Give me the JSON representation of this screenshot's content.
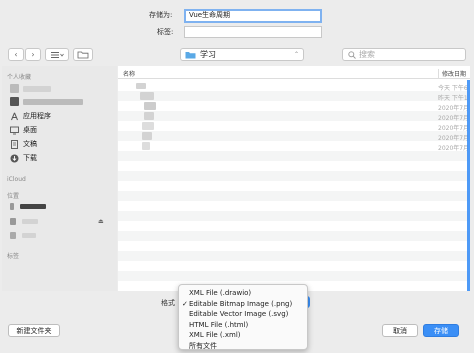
{
  "save_as": {
    "label": "存储为:",
    "value": "Vue生命周期"
  },
  "tags": {
    "label": "标签:",
    "value": ""
  },
  "toolbar": {
    "back_icon": "chevron-left-icon",
    "forward_icon": "chevron-right-icon",
    "view_icon": "list-view-icon",
    "new_folder_icon": "new-folder-icon",
    "location": "学习",
    "search_placeholder": "搜索"
  },
  "sidebar": {
    "favorites_header": "个人收藏",
    "favorites": [
      {
        "label": "",
        "icon": "home-icon"
      },
      {
        "label": "",
        "icon": "desktop-folder-icon"
      },
      {
        "label": "应用程序",
        "icon": "applications-icon"
      },
      {
        "label": "桌面",
        "icon": "desktop-icon"
      },
      {
        "label": "文稿",
        "icon": "documents-icon"
      },
      {
        "label": "下载",
        "icon": "downloads-icon"
      }
    ],
    "icloud_header": "iCloud",
    "locations_header": "位置",
    "tags_header": "标签"
  },
  "file_list": {
    "col_name": "名称",
    "col_modified": "修改日期",
    "rows": [
      {
        "modified": "今天 下午6"
      },
      {
        "modified": "昨天 下午1"
      },
      {
        "modified": "2020年7月"
      },
      {
        "modified": "2020年7月"
      },
      {
        "modified": "2020年7月"
      },
      {
        "modified": "2020年7月"
      },
      {
        "modified": "2020年7月"
      }
    ]
  },
  "format": {
    "label": "格式",
    "options": [
      {
        "label": "XML File (.drawio)",
        "checked": false
      },
      {
        "label": "Editable Bitmap Image (.png)",
        "checked": true
      },
      {
        "label": "Editable Vector Image (.svg)",
        "checked": false
      },
      {
        "label": "HTML File (.html)",
        "checked": false
      },
      {
        "label": "XML File (.xml)",
        "checked": false
      },
      {
        "label": "所有文件",
        "checked": false
      }
    ],
    "check_mark": "✓"
  },
  "buttons": {
    "new_folder": "新建文件夹",
    "cancel": "取消",
    "save": "存储"
  },
  "colors": {
    "accent": "#3b8ff6",
    "folder": "#5aa9e6"
  }
}
